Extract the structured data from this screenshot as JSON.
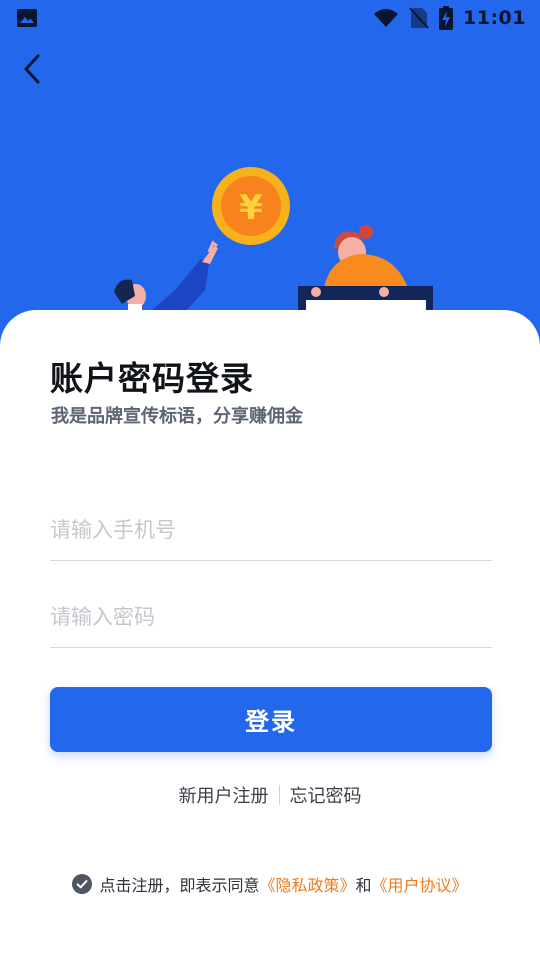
{
  "status_bar": {
    "time": "11:01",
    "left_icon": "image-icon",
    "right_icons": [
      "wifi-icon",
      "no-sim-icon",
      "battery-charging-icon"
    ]
  },
  "nav": {
    "back_icon": "chevron-left-icon"
  },
  "hero": {
    "illustration": "coin-exchange-illustration",
    "coin_symbol": "¥",
    "colors": {
      "background": "#2368ec",
      "coin": "#f5b21b",
      "accent": "#f88a1e"
    }
  },
  "login": {
    "title": "账户密码登录",
    "subtitle": "我是品牌宣传标语，分享赚佣金",
    "phone": {
      "value": "",
      "placeholder": "请输入手机号"
    },
    "password": {
      "value": "",
      "placeholder": "请输入密码"
    },
    "submit_label": "登录",
    "register_label": "新用户注册",
    "forgot_label": "忘记密码"
  },
  "agreement": {
    "checked": true,
    "prefix": "点击注册，即表示同意",
    "privacy_label": "《隐私政策》",
    "conjunction": "和",
    "terms_label": "《用户协议》",
    "link_color": "#f07a1d"
  }
}
